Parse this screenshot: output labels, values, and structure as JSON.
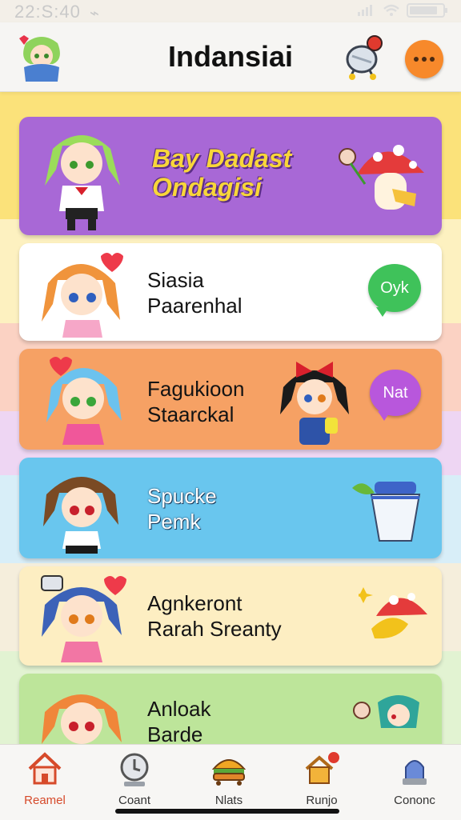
{
  "status": {
    "time": "22:S:40"
  },
  "header": {
    "title": "Indansiai"
  },
  "cards": [
    {
      "lines": [
        "Bay Dadast",
        "Ondagisi"
      ],
      "bubble": "",
      "color": "#a868d6"
    },
    {
      "lines": [
        "Siasia",
        "Paarenhal"
      ],
      "bubble": "Oyk",
      "color": "#ffffff"
    },
    {
      "lines": [
        "Fagukioon",
        "Staarckal"
      ],
      "bubble": "Nat",
      "color": "#f6a164"
    },
    {
      "lines": [
        "Spucke",
        "Pemk"
      ],
      "bubble": "",
      "color": "#69c6ee"
    },
    {
      "lines": [
        "Agnkeront",
        "Rarah Sreanty"
      ],
      "bubble": "",
      "color": "#fdeec2"
    },
    {
      "lines": [
        "Anloak",
        "Barde"
      ],
      "bubble": "",
      "color": "#bde59a"
    }
  ],
  "nav": [
    {
      "label": "Reamel",
      "icon": "home-icon",
      "active": true
    },
    {
      "label": "Coant",
      "icon": "clock-icon",
      "active": false
    },
    {
      "label": "Nlats",
      "icon": "burger-icon",
      "active": false
    },
    {
      "label": "Runjo",
      "icon": "house-flag-icon",
      "active": false
    },
    {
      "label": "Cononc",
      "icon": "figure-icon",
      "active": false
    }
  ],
  "colors": {
    "accent": "#f7892b",
    "active_nav": "#d64a2a"
  }
}
